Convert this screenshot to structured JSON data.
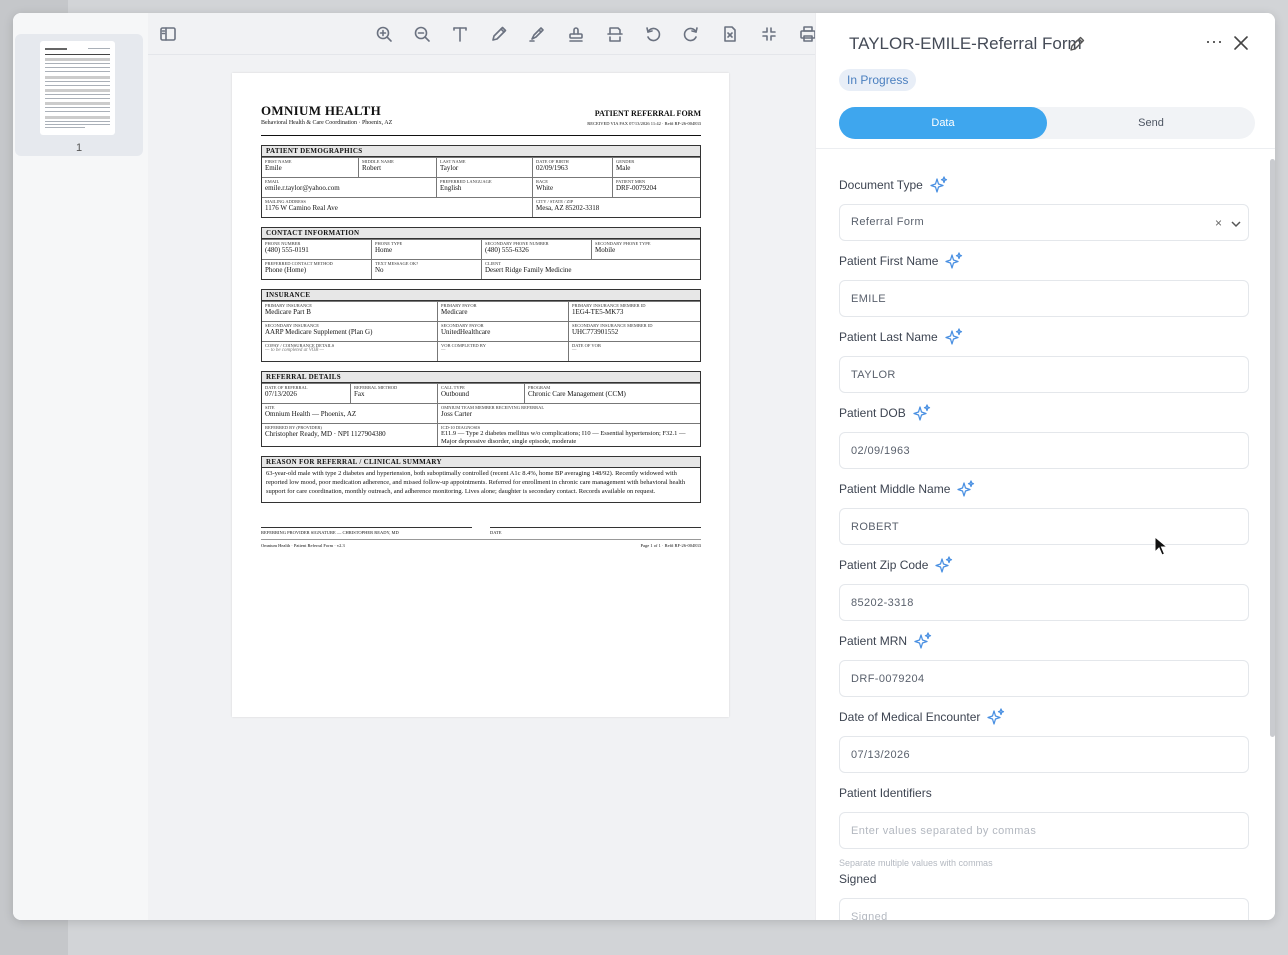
{
  "thumbnails": {
    "page_number": "1"
  },
  "toolbar": {
    "icons": [
      "sidebar-toggle-icon",
      "zoom-in-icon",
      "zoom-out-icon",
      "text-icon",
      "pen-icon",
      "highlighter-icon",
      "stamp-icon",
      "page-extract-icon",
      "rotate-left-icon",
      "rotate-right-icon",
      "delete-page-icon",
      "collapse-icon",
      "print-icon"
    ]
  },
  "document": {
    "org_name": "OMNIUM HEALTH",
    "org_subtitle": "Behavioral Health & Care Coordination · Phoenix, AZ",
    "form_title": "PATIENT REFERRAL FORM",
    "form_received": "RECEIVED VIA FAX 07/13/2026 11:42 · Ref# RF-26-004833",
    "demographics": {
      "header": "PATIENT DEMOGRAPHICS",
      "first_name_label": "FIRST NAME",
      "first_name": "Emile",
      "middle_name_label": "MIDDLE NAME",
      "middle_name": "Robert",
      "last_name_label": "LAST NAME",
      "last_name": "Taylor",
      "dob_label": "DATE OF BIRTH",
      "dob": "02/09/1963",
      "gender_label": "GENDER",
      "gender": "Male",
      "email_label": "EMAIL",
      "email": "emile.r.taylor@yahoo.com",
      "language_label": "PREFERRED LANGUAGE",
      "language": "English",
      "race_label": "RACE",
      "race": "White",
      "mrn_label": "PATIENT MRN",
      "mrn": "DRF-0079204",
      "address_label": "MAILING ADDRESS",
      "address": "1176 W Camino Real Ave",
      "city_label": "CITY / STATE / ZIP",
      "city": "Mesa, AZ 85202-3318"
    },
    "contact": {
      "header": "CONTACT INFORMATION",
      "phone_label": "PHONE NUMBER",
      "phone": "(480) 555-0191",
      "phone_type_label": "PHONE TYPE",
      "phone_type": "Home",
      "sec_phone_label": "SECONDARY PHONE NUMBER",
      "sec_phone": "(480) 555-6326",
      "sec_phone_type_label": "SECONDARY PHONE TYPE",
      "sec_phone_type": "Mobile",
      "method_label": "PREFERRED CONTACT METHOD",
      "method": "Phone (Home)",
      "text_ok_label": "TEXT MESSAGE OK?",
      "text_ok": "No",
      "client_label": "CLIENT",
      "client": "Desert Ridge Family Medicine"
    },
    "insurance": {
      "header": "INSURANCE",
      "primary_label": "PRIMARY INSURANCE",
      "primary": "Medicare Part B",
      "primary_payor_label": "PRIMARY PAYOR",
      "primary_payor": "Medicare",
      "primary_id_label": "PRIMARY INSURANCE MEMBER ID",
      "primary_id": "1EG4-TE5-MK73",
      "secondary_label": "SECONDARY INSURANCE",
      "secondary": "AARP Medicare Supplement (Plan G)",
      "secondary_payor_label": "SECONDARY PAYOR",
      "secondary_payor": "UnitedHealthcare",
      "secondary_id_label": "SECONDARY INSURANCE MEMBER ID",
      "secondary_id": "UHC773901552",
      "copay_label": "COPAY / COINSURANCE DETAILS",
      "copay": "— to be completed at VOB —",
      "vob_by_label": "VOB COMPLETED BY",
      "vob_by": "—",
      "vob_date_label": "DATE OF VOB",
      "vob_date": "—"
    },
    "referral": {
      "header": "REFERRAL DETAILS",
      "date_label": "DATE OF REFERRAL",
      "date": "07/13/2026",
      "method_label": "REFERRAL METHOD",
      "method": "Fax",
      "call_type_label": "CALL TYPE",
      "call_type": "Outbound",
      "program_label": "PROGRAM",
      "program": "Chronic Care Management (CCM)",
      "site_label": "SITE",
      "site": "Omnium Health — Phoenix, AZ",
      "team_label": "OMNIUM TEAM MEMBER RECEIVING REFERRAL",
      "team": "Joss Carter",
      "provider_label": "REFERRED BY (PROVIDER)",
      "provider": "Christopher Ready, MD · NPI 1127904380",
      "icd_label": "ICD-10 DIAGNOSIS",
      "icd": "E11.9 — Type 2 diabetes mellitus w/o complications; I10 — Essential hypertension; F32.1 — Major depressive disorder, single episode, moderate"
    },
    "summary": {
      "header": "REASON FOR REFERRAL / CLINICAL SUMMARY",
      "text": "63-year-old male with type 2 diabetes and hypertension, both suboptimally controlled (recent A1c 8.4%, home BP averaging 148/92). Recently widowed with reported low mood, poor medication adherence, and missed follow-up appointments. Referred for enrollment in chronic care management with behavioral health support for care coordination, monthly outreach, and adherence monitoring. Lives alone; daughter is secondary contact. Records available on request."
    },
    "signature_label": "REFERRING PROVIDER SIGNATURE — CHRISTOPHER READY, MD",
    "date_label": "DATE",
    "footer_left": "Omnium Health · Patient Referral Form · v2.3",
    "footer_right": "Page 1 of 1 · Ref# RF-26-004833"
  },
  "panel": {
    "title": "TAYLOR-EMILE-Referral Form",
    "status": "In Progress",
    "tabs": [
      "Data",
      "Send"
    ],
    "fields": {
      "doc_type": {
        "label": "Document Type",
        "value": "Referral Form"
      },
      "first_name": {
        "label": "Patient First Name",
        "value": "EMILE"
      },
      "last_name": {
        "label": "Patient Last Name",
        "value": "TAYLOR"
      },
      "dob": {
        "label": "Patient DOB",
        "value": "02/09/1963"
      },
      "middle_name": {
        "label": "Patient Middle Name",
        "value": "ROBERT"
      },
      "zip": {
        "label": "Patient Zip Code",
        "value": "85202-3318"
      },
      "mrn": {
        "label": "Patient MRN",
        "value": "DRF-0079204"
      },
      "encounter": {
        "label": "Date of Medical Encounter",
        "value": "07/13/2026"
      },
      "identifiers": {
        "label": "Patient Identifiers",
        "placeholder": "Enter values separated by commas",
        "hint": "Separate multiple values with commas"
      },
      "signed": {
        "label": "Signed",
        "placeholder": "Signed"
      }
    },
    "accent_color": "#3ea6ee",
    "sparkle_color": "#4a90e2"
  }
}
